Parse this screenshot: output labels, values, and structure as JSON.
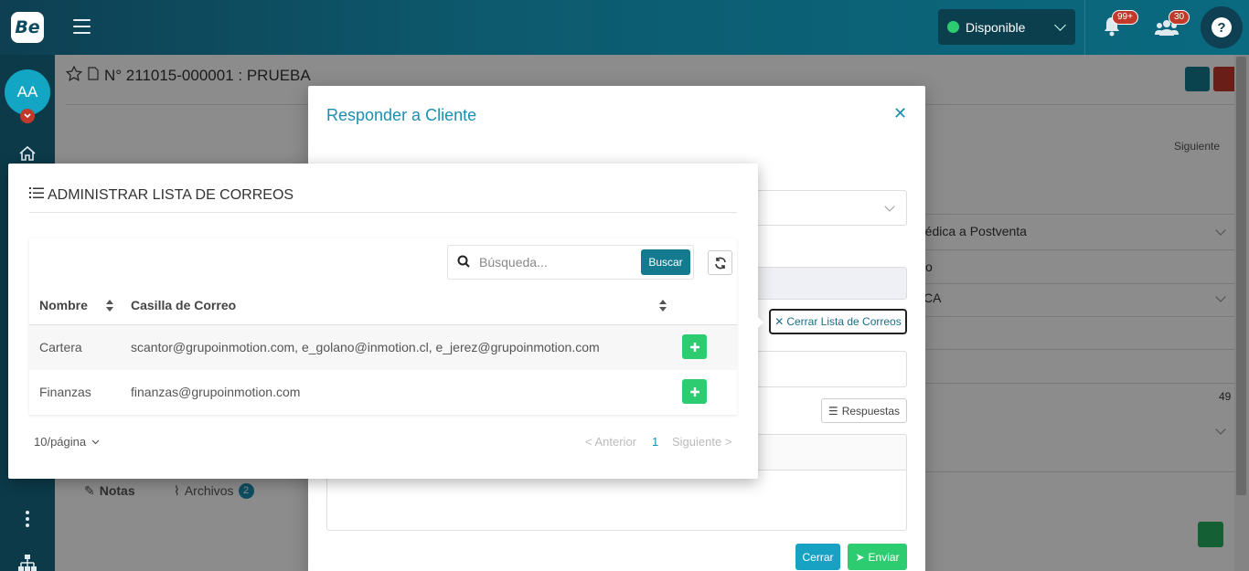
{
  "app": {
    "logo": "Be"
  },
  "topbar": {
    "status": "Disponible",
    "notifications_badge": "99+",
    "users_badge": "30"
  },
  "sidebar": {
    "avatar_initials": "AA"
  },
  "page": {
    "title": "N° 211015-000001 : PRUEBA",
    "next_label": "Siguiente",
    "bg_field_1": "médica a Postventa",
    "bg_field_2": "o",
    "bg_field_3": "CA",
    "bg_field_4": "49",
    "tabs": [
      {
        "label": "Notas"
      },
      {
        "label": "Archivos",
        "count": "2"
      }
    ]
  },
  "modal": {
    "title": "Responder a Cliente",
    "close_list_label": "Cerrar Lista de Correos",
    "responses_label": "Respuestas",
    "close_button": "Cerrar",
    "send_button": "Enviar"
  },
  "popover": {
    "title": "ADMINISTRAR LISTA DE CORREOS",
    "search_placeholder": "Búsqueda...",
    "search_button": "Buscar",
    "columns": [
      "Nombre",
      "Casilla de Correo"
    ],
    "rows": [
      {
        "name": "Cartera",
        "email": "scantor@grupoinmotion.com, e_golano@inmotion.cl, e_jerez@grupoinmotion.com"
      },
      {
        "name": "Finanzas",
        "email": "finanzas@grupoinmotion.com"
      }
    ],
    "page_size": "10/página",
    "prev": "< Anterior",
    "current_page": "1",
    "next": "Siguiente >"
  },
  "colors": {
    "accent": "#1a8fb0",
    "primary_dark": "#137a8f",
    "success": "#2ecc71",
    "danger": "#c0392b"
  }
}
